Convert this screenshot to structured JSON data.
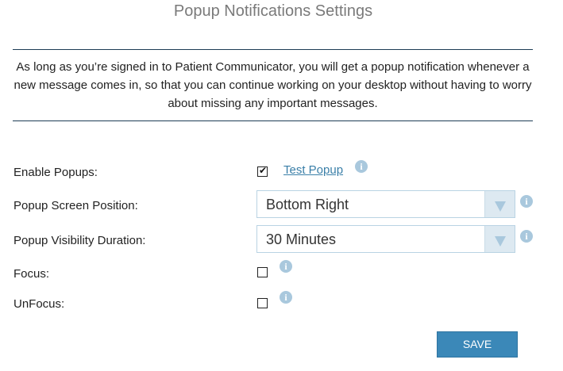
{
  "page": {
    "title": "Popup Notifications Settings",
    "description": "As long as you’re signed in to Patient Communicator, you will get a popup notification whenever a new message comes in, so that you can continue working on your desktop without having to worry about missing any important messages."
  },
  "settings": {
    "enable_popups": {
      "label": "Enable Popups:",
      "checked": true,
      "test_link": "Test Popup"
    },
    "position": {
      "label": "Popup Screen Position:",
      "value": "Bottom Right"
    },
    "duration": {
      "label": "Popup Visibility Duration:",
      "value": "30 Minutes"
    },
    "focus": {
      "label": "Focus:",
      "checked": false
    },
    "unfocus": {
      "label": "UnFocus:",
      "checked": false
    }
  },
  "icons": {
    "info": "i",
    "check": "✔"
  },
  "actions": {
    "save_label": "SAVE"
  },
  "colors": {
    "accent": "#3b88b8",
    "link": "#3a7fa8",
    "info_icon": "#a9c8dd",
    "rule": "#1d3c55"
  }
}
